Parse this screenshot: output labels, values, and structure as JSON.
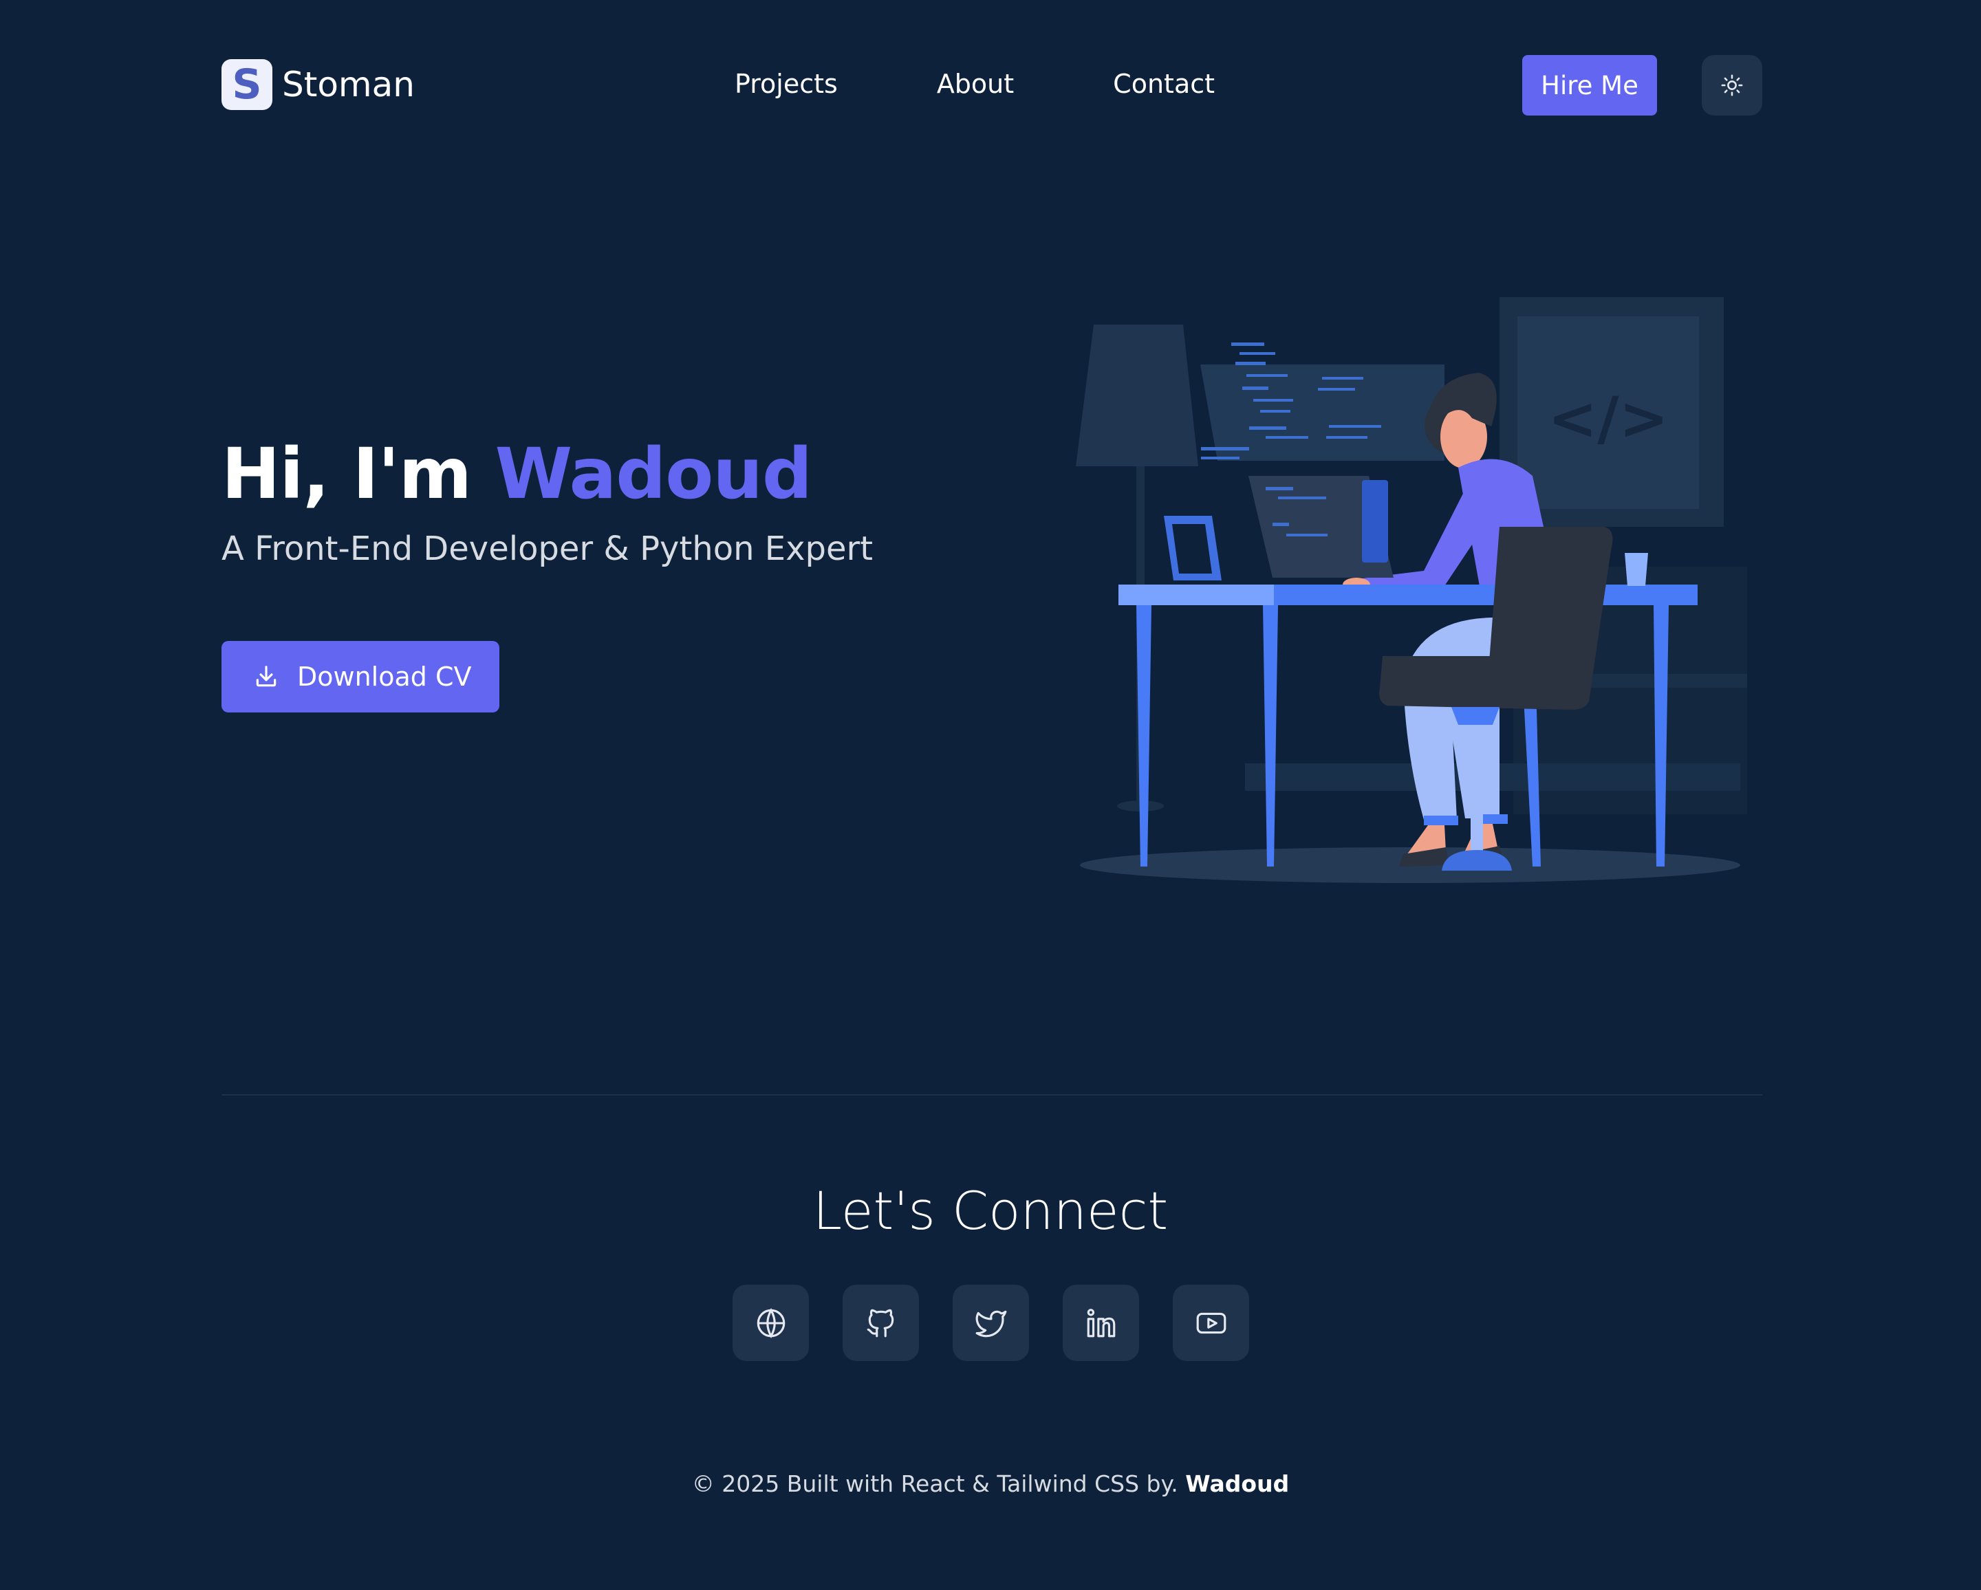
{
  "brand": {
    "logo_letter": "S",
    "name": "Stoman"
  },
  "nav": {
    "links": [
      "Projects",
      "About",
      "Contact"
    ],
    "hire_label": "Hire Me",
    "theme_icon": "sun-icon"
  },
  "hero": {
    "greeting": "Hi, I'm",
    "name": "Wadoud",
    "subtitle": "A Front-End Developer & Python Expert",
    "cv_label": "Download CV",
    "illustration_text": "</>"
  },
  "connect": {
    "title": "Let's Connect",
    "icons": [
      "globe-icon",
      "github-icon",
      "twitter-icon",
      "linkedin-icon",
      "youtube-icon"
    ]
  },
  "footer": {
    "text": "© 2025 Built with React & Tailwind CSS by.",
    "author": "Wadoud"
  },
  "colors": {
    "background": "#0e213a",
    "accent": "#6366f1",
    "card": "#1f334d"
  }
}
